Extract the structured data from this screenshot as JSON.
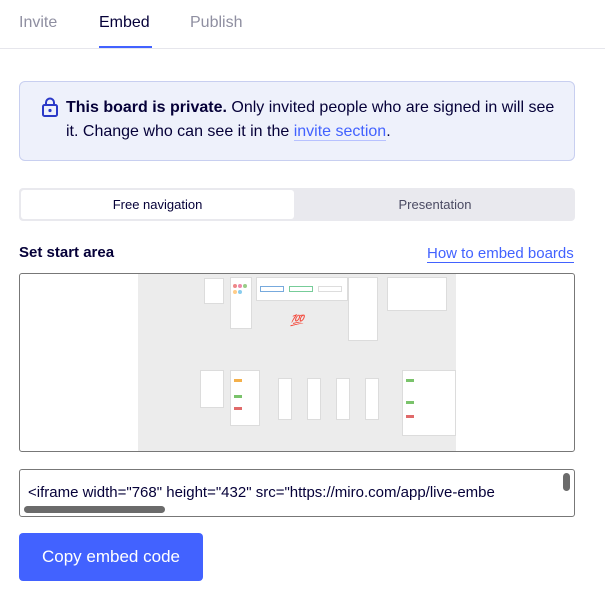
{
  "tabs": [
    {
      "label": "Invite"
    },
    {
      "label": "Embed"
    },
    {
      "label": "Publish"
    }
  ],
  "banner": {
    "bold": "This board is private.",
    "text_before_link": " Only invited people who are signed in will see it. Change who can see it in the ",
    "link": "invite section",
    "text_after_link": "."
  },
  "navigation_mode": {
    "options": [
      "Free navigation",
      "Presentation"
    ],
    "selected": "Free navigation"
  },
  "start_area": {
    "title": "Set start area",
    "help_link": "How to embed boards"
  },
  "embed_code": "<iframe width=\"768\" height=\"432\" src=\"https://miro.com/app/live-embe",
  "copy_button": "Copy embed code",
  "colors": {
    "accent": "#4262ff",
    "banner_bg": "#eef1fb",
    "sticky": "#f7e36b"
  }
}
